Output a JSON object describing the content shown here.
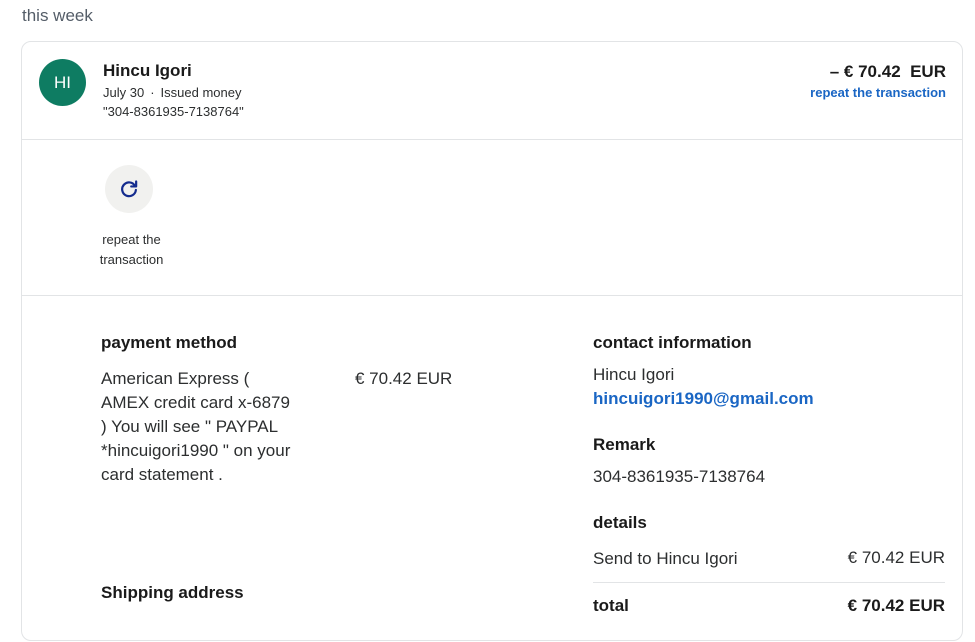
{
  "section": {
    "heading": "this week"
  },
  "transaction": {
    "avatar_initials": "HI",
    "avatar_color": "#0e7c62",
    "name": "Hincu Igori",
    "date": "July 30",
    "separator": "·",
    "type": "Issued money",
    "reference": "\"304-8361935-7138764\"",
    "amount": "– € 70.42  EUR",
    "repeat_link": "repeat the transaction"
  },
  "actions": {
    "repeat_icon": "refresh-icon",
    "repeat_label": "repeat the transaction"
  },
  "payment_method": {
    "heading": "payment method",
    "description": "American Express ( AMEX credit card x-6879 ) You will see \" PAYPAL *hincuigori1990 \" on your card statement .",
    "amount": "€ 70.42 EUR"
  },
  "shipping": {
    "heading": "Shipping address"
  },
  "contact": {
    "heading": "contact information",
    "name": "Hincu Igori",
    "email": "hincuigori1990@gmail.com"
  },
  "remark": {
    "heading": "Remark",
    "value": "304-8361935-7138764"
  },
  "details": {
    "heading": "details",
    "line_label": "Send to Hincu Igori",
    "line_amount": "€ 70.42 EUR",
    "total_label": "total",
    "total_amount": "€ 70.42 EUR"
  },
  "colors": {
    "link": "#1a66c4",
    "avatar": "#0e7c62",
    "border": "#e2e4e6"
  }
}
